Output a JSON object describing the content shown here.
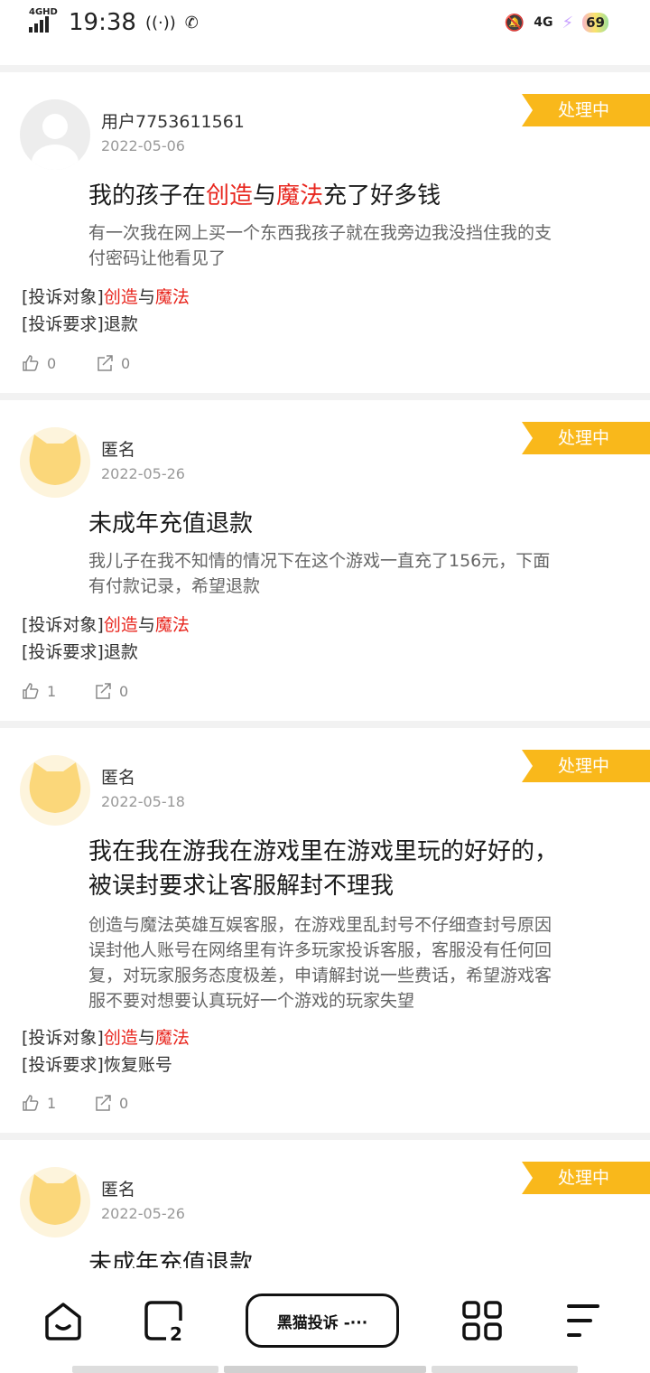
{
  "status_bar": {
    "network": "4GHD",
    "time": "19:38",
    "right_network": "4G",
    "battery": "69"
  },
  "labels": {
    "target_prefix": "[投诉对象]",
    "request_prefix": "[投诉要求]",
    "brand_part1": "创造",
    "brand_joiner": "与",
    "brand_part2": "魔法"
  },
  "complaints": [
    {
      "user": "用户7753611561",
      "date": "2022-05-06",
      "status": "处理中",
      "title_before": "我的孩子在",
      "title_mid": "与",
      "title_after": "充了好多钱",
      "description": "有一次我在网上买一个东西我孩子就在我旁边我没挡住我的支付密码让他看见了",
      "request": "退款",
      "likes": "0",
      "shares": "0"
    },
    {
      "user": "匿名",
      "date": "2022-05-26",
      "status": "处理中",
      "title": "未成年充值退款",
      "description": "我儿子在我不知情的情况下在这个游戏一直充了156元，下面有付款记录，希望退款",
      "request": "退款",
      "likes": "1",
      "shares": "0"
    },
    {
      "user": "匿名",
      "date": "2022-05-18",
      "status": "处理中",
      "title": "我在我在游我在游戏里在游戏里玩的好好的，被误封要求让客服解封不理我",
      "description": "创造与魔法英雄互娱客服，在游戏里乱封号不仔细查封号原因误封他人账号在网络里有许多玩家投诉客服，客服没有任何回复，对玩家服务态度极差，申请解封说一些费话，希望游戏客服不要对想要认真玩好一个游戏的玩家失望",
      "request": "恢复账号",
      "likes": "1",
      "shares": "0"
    },
    {
      "user": "匿名",
      "date": "2022-05-26",
      "status": "处理中",
      "title": "未成年充值退款"
    }
  ],
  "bottom_nav": {
    "pill_label": "黑猫投诉 -···"
  }
}
